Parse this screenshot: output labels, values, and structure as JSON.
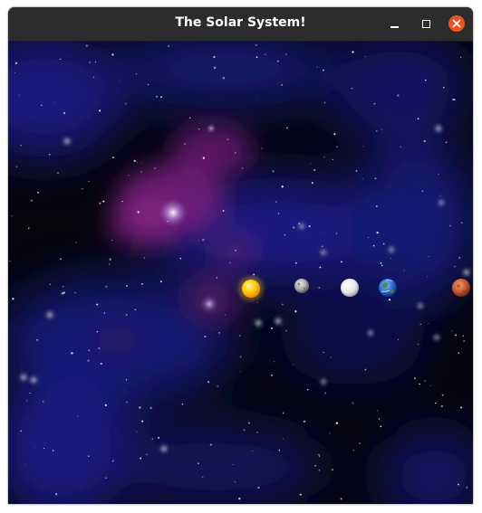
{
  "window": {
    "title": "The Solar System!"
  },
  "controls": {
    "minimize_icon": "minimize-icon",
    "maximize_icon": "maximize-icon",
    "close_icon": "close-icon",
    "close_color": "#e95420"
  },
  "scene": {
    "background": "starfield with blue and magenta nebula",
    "bodies": [
      {
        "name": "sun",
        "color": "#ffb300"
      },
      {
        "name": "mercury",
        "color": "#b5b5b5"
      },
      {
        "name": "venus",
        "color": "#f2f2f2"
      },
      {
        "name": "earth",
        "color": "#2f6fd6"
      },
      {
        "name": "mars",
        "color": "#c4572f"
      }
    ]
  }
}
